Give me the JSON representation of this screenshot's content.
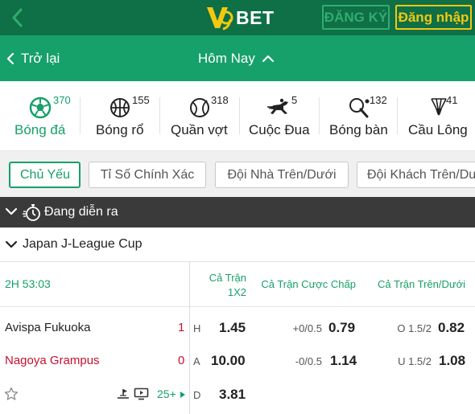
{
  "header": {
    "logo_text": "BET",
    "register_label": "ĐĂNG KÝ",
    "login_label": "Đăng nhập",
    "colors": {
      "header_bg": "#0f6f47",
      "accent_green": "#16a06a",
      "login_yellow": "#f2c811"
    }
  },
  "nav": {
    "back_label": "Trở lại",
    "title": "Hôm Nay"
  },
  "sports": [
    {
      "label": "Bóng đá",
      "count": "370",
      "icon": "soccer-ball-icon",
      "active": true
    },
    {
      "label": "Bóng rổ",
      "count": "155",
      "icon": "basketball-icon",
      "active": false
    },
    {
      "label": "Quần vợt",
      "count": "318",
      "icon": "tennis-ball-icon",
      "active": false
    },
    {
      "label": "Cuộc Đua",
      "count": "5",
      "icon": "horse-racing-icon",
      "active": false
    },
    {
      "label": "Bóng bàn",
      "count": "132",
      "icon": "table-tennis-icon",
      "active": false
    },
    {
      "label": "Cầu Lông",
      "count": "41",
      "icon": "shuttlecock-icon",
      "active": false
    }
  ],
  "filters": [
    {
      "label": "Chủ Yếu",
      "active": true
    },
    {
      "label": "Tỉ Số Chính Xác",
      "active": false
    },
    {
      "label": "Đội Nhà Trên/Dưới",
      "active": false
    },
    {
      "label": "Đội Khách Trên/Dưới",
      "active": false
    }
  ],
  "live_section": {
    "label": "Đang diễn ra"
  },
  "league": {
    "name": "Japan J-League Cup"
  },
  "markets": {
    "match_time": "2H 53:03",
    "col_1x2_line1": "Cả Trận",
    "col_1x2_line2": "1X2",
    "col_handicap": "Cả Trận Cược Chấp",
    "col_over_under": "Cả Trận Trên/Dưới"
  },
  "match": {
    "home_team": "Avispa Fukuoka",
    "home_score": "1",
    "away_team": "Nagoya Grampus",
    "away_score": "0",
    "more_markets": "25+",
    "rows": [
      {
        "letter": "H",
        "odds_1x2": "1.45",
        "handicap_line": "+0/0.5",
        "handicap_odds": "0.79",
        "ou_line": "O 1.5/2",
        "ou_odds": "0.82"
      },
      {
        "letter": "A",
        "odds_1x2": "10.00",
        "handicap_line": "-0/0.5",
        "handicap_odds": "1.14",
        "ou_line": "U 1.5/2",
        "ou_odds": "1.08"
      },
      {
        "letter": "D",
        "odds_1x2": "3.81"
      }
    ]
  }
}
